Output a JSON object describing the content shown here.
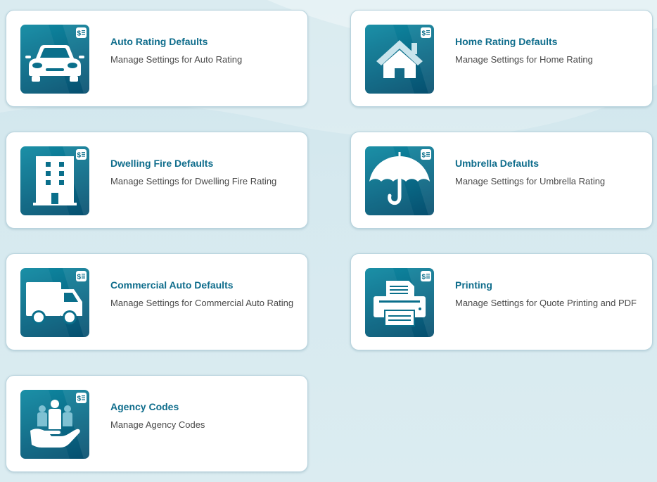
{
  "cards": [
    {
      "title": "Auto Rating Defaults",
      "desc": "Manage Settings for Auto Rating",
      "icon": "car-icon"
    },
    {
      "title": "Home Rating Defaults",
      "desc": "Manage Settings for Home Rating",
      "icon": "house-icon"
    },
    {
      "title": "Dwelling Fire Defaults",
      "desc": "Manage Settings for Dwelling Fire Rating",
      "icon": "building-icon"
    },
    {
      "title": "Umbrella Defaults",
      "desc": "Manage Settings for Umbrella Rating",
      "icon": "umbrella-icon"
    },
    {
      "title": "Commercial Auto Defaults",
      "desc": "Manage Settings for Commercial Auto Rating",
      "icon": "truck-icon"
    },
    {
      "title": "Printing",
      "desc": "Manage Settings for Quote Printing and PDF",
      "icon": "printer-icon"
    },
    {
      "title": "Agency Codes",
      "desc": "Manage Agency Codes",
      "icon": "people-hand-icon"
    }
  ],
  "badge_icon": "dollar-list-icon",
  "colors": {
    "title": "#0f6d8c",
    "tile_top": "#0f8aa3",
    "tile_bottom": "#064e6e",
    "description": "#4a4a4a"
  }
}
